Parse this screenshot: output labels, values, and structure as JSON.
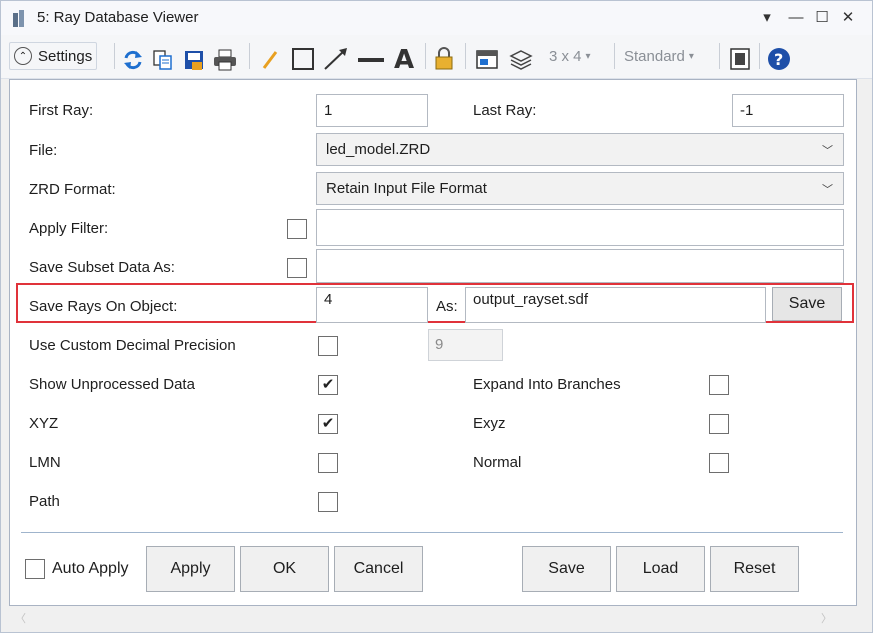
{
  "window": {
    "title": "5: Ray Database Viewer",
    "controls": {
      "menu": "▾",
      "minimize": "—",
      "maximize": "☐",
      "close": "✕"
    }
  },
  "toolbar": {
    "settings_label": "Settings",
    "grid_label": "3 x 4",
    "grid_caret": "▾",
    "style_label": "Standard",
    "style_caret": "▾",
    "icons": [
      "refresh-icon",
      "copy-icon",
      "save-image-icon",
      "print-icon",
      "pencil-icon",
      "rectangle-icon",
      "arrow-icon",
      "line-icon",
      "text-icon",
      "lock-icon",
      "window-icon",
      "layers-icon",
      "layout-icon",
      "help-icon"
    ]
  },
  "form": {
    "first_ray_label": "First Ray:",
    "first_ray_value": "1",
    "last_ray_label": "Last Ray:",
    "last_ray_value": "-1",
    "file_label": "File:",
    "file_value": "led_model.ZRD",
    "zrd_format_label": "ZRD Format:",
    "zrd_format_value": "Retain Input File Format",
    "apply_filter_label": "Apply Filter:",
    "apply_filter_value": "",
    "save_subset_label": "Save Subset Data As:",
    "save_subset_value": "",
    "save_rays_label": "Save Rays On Object:",
    "save_rays_object": "4",
    "as_label": "As:",
    "save_rays_file": "output_rayset.sdf",
    "save_rays_button": "Save",
    "custom_precision_label": "Use Custom Decimal Precision",
    "custom_precision_value": "9",
    "show_unprocessed_label": "Show Unprocessed Data",
    "expand_branches_label": "Expand Into Branches",
    "xyz_label": "XYZ",
    "exyz_label": "Exyz",
    "lmn_label": "LMN",
    "normal_label": "Normal",
    "path_label": "Path",
    "check_mark": "✔",
    "checked": {
      "apply_filter": false,
      "save_subset": false,
      "custom_precision": false,
      "show_unprocessed": true,
      "expand_branches": false,
      "xyz": true,
      "exyz": false,
      "lmn": false,
      "normal": false,
      "path": false,
      "auto_apply": false
    }
  },
  "footer": {
    "auto_apply_label": "Auto Apply",
    "apply": "Apply",
    "ok": "OK",
    "cancel": "Cancel",
    "save": "Save",
    "load": "Load",
    "reset": "Reset"
  },
  "colors": {
    "highlight": "#e0323a",
    "accent_blue": "#1e6fcf"
  }
}
